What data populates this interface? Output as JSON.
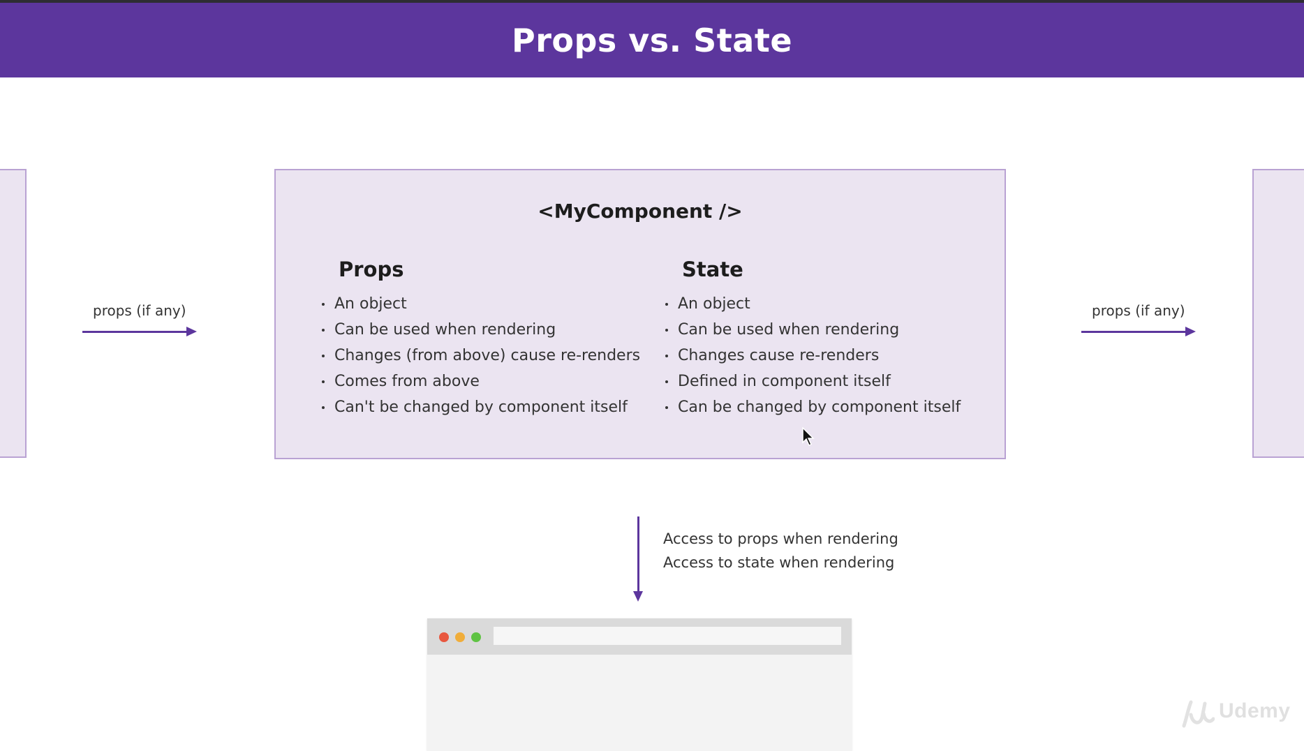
{
  "header": {
    "title": "Props vs. State"
  },
  "component": {
    "title": "<MyComponent />"
  },
  "props": {
    "heading": "Props",
    "items": [
      "An object",
      "Can be used when rendering",
      "Changes (from above) cause re-renders",
      "Comes from above",
      "Can't be changed by component itself"
    ]
  },
  "state": {
    "heading": "State",
    "items": [
      "An object",
      "Can be used when rendering",
      "Changes cause re-renders",
      "Defined in component itself",
      "Can be changed by component itself"
    ]
  },
  "arrows": {
    "incoming_label": "props (if any)",
    "outgoing_label": "props (if any)"
  },
  "render": {
    "line1": "Access to props when rendering",
    "line2": "Access to state when rendering"
  },
  "browser": {
    "dot_colors": [
      "#e8573f",
      "#f0ad3a",
      "#5fc343"
    ],
    "accent": "#5c369d"
  },
  "watermark": {
    "text": "Udemy"
  }
}
